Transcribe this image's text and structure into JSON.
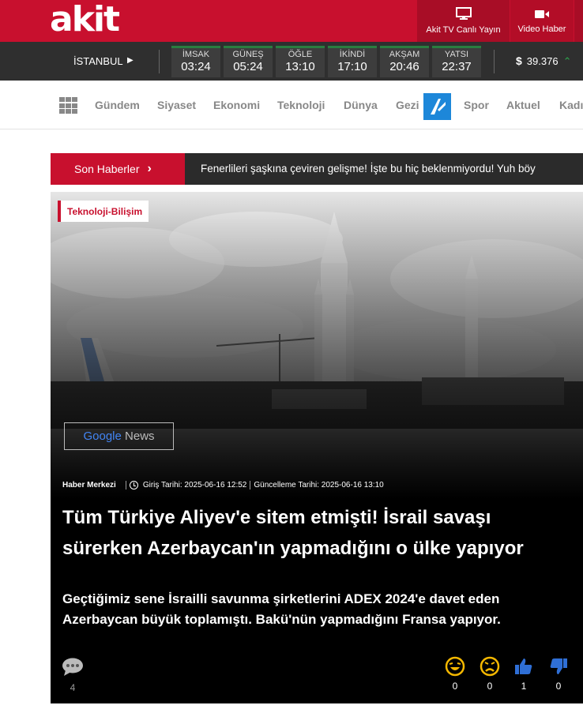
{
  "header": {
    "logo": "akit",
    "tv_label": "Akit TV Canlı Yayın",
    "video_label": "Video Haber"
  },
  "prayer": {
    "city": "İSTANBUL",
    "times": [
      {
        "name": "İMSAK",
        "time": "03:24"
      },
      {
        "name": "GÜNEŞ",
        "time": "05:24"
      },
      {
        "name": "ÖĞLE",
        "time": "13:10"
      },
      {
        "name": "İKİNDİ",
        "time": "17:10"
      },
      {
        "name": "AKŞAM",
        "time": "20:46"
      },
      {
        "name": "YATSI",
        "time": "22:37"
      }
    ],
    "currency_symbol": "$",
    "currency_value": "39.376"
  },
  "nav": {
    "items": [
      "Gündem",
      "Siyaset",
      "Ekonomi",
      "Teknoloji",
      "Dünya",
      "Gezi",
      "Spor",
      "Aktuel",
      "Kadı"
    ]
  },
  "breaking": {
    "label": "Son Haberler",
    "text": "Fenerlileri şaşkına çeviren gelişme! İşte bu hiç beklenmiyordu! Yuh böy"
  },
  "article": {
    "category": "Teknoloji-Bilişim",
    "gnews_google": "Google",
    "gnews_news": "News",
    "author": "Haber Merkezi",
    "published": "Giriş Tarihi: 2025-06-16 12:52",
    "updated": "Güncelleme Tarihi: 2025-06-16 13:10",
    "headline": "Tüm Türkiye Aliyev'e sitem etmişti! İsrail savaşı sürerken Azerbaycan'ın yapmadığını o ülke yapıyor",
    "summary": "Geçtiğimiz sene İsrailli savunma şirketlerini ADEX 2024'e davet eden Azerbaycan büyük toplamıştı. Bakü'nün yapmadığını Fransa yapıyor.",
    "comment_count": "4",
    "reactions": [
      {
        "name": "laugh",
        "count": "0"
      },
      {
        "name": "sad",
        "count": "0"
      },
      {
        "name": "like",
        "count": "1"
      },
      {
        "name": "dislike",
        "count": "0"
      }
    ]
  },
  "colors": {
    "brand_red": "#c8102e",
    "dark_bar": "#2f2f2f",
    "prayer_accent": "#2a7d3f",
    "reaction_yellow": "#f5b800",
    "reaction_blue": "#2f6fd6"
  }
}
